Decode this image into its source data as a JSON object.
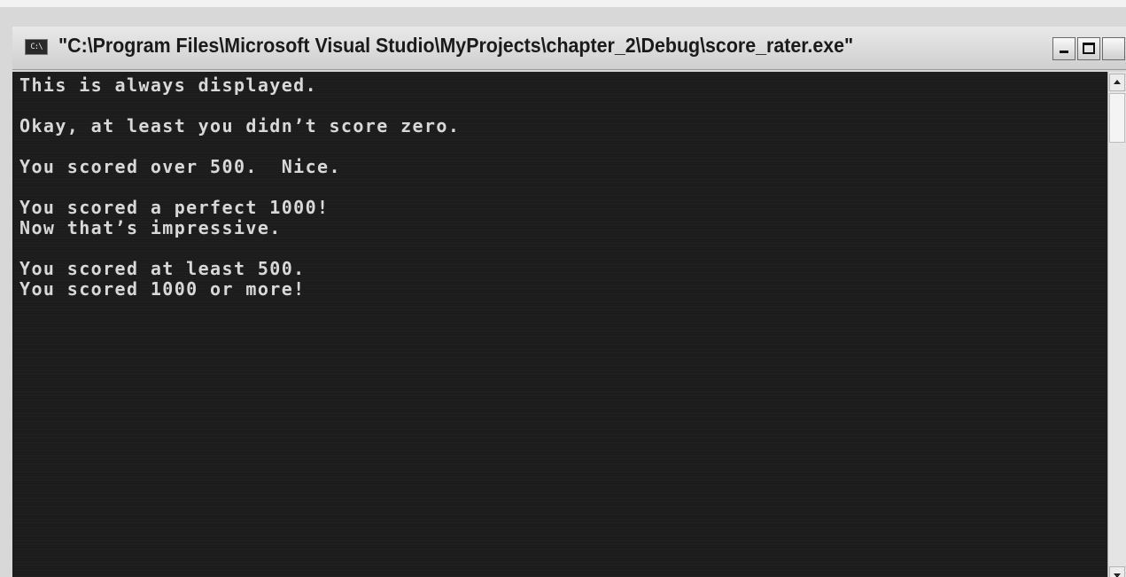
{
  "window": {
    "title": "\"C:\\Program Files\\Microsoft Visual Studio\\MyProjects\\chapter_2\\Debug\\score_rater.exe\"",
    "icon_text": "C:\\",
    "icon": "console-app-icon",
    "buttons": {
      "minimize_icon": "minimize-icon",
      "maximize_icon": "maximize-icon"
    }
  },
  "console": {
    "background": "#1c1c1c",
    "foreground": "#d8d8d8",
    "lines": [
      "This is always displayed.",
      "Okay, at least you didn’t score zero.",
      "You scored over 500.  Nice.",
      "You scored a perfect 1000!",
      "Now that’s impressive.",
      "You scored at least 500.",
      "You scored 1000 or more!"
    ]
  },
  "scrollbar": {
    "up_icon": "scroll-up-arrow-icon",
    "down_icon": "scroll-down-arrow-icon"
  }
}
